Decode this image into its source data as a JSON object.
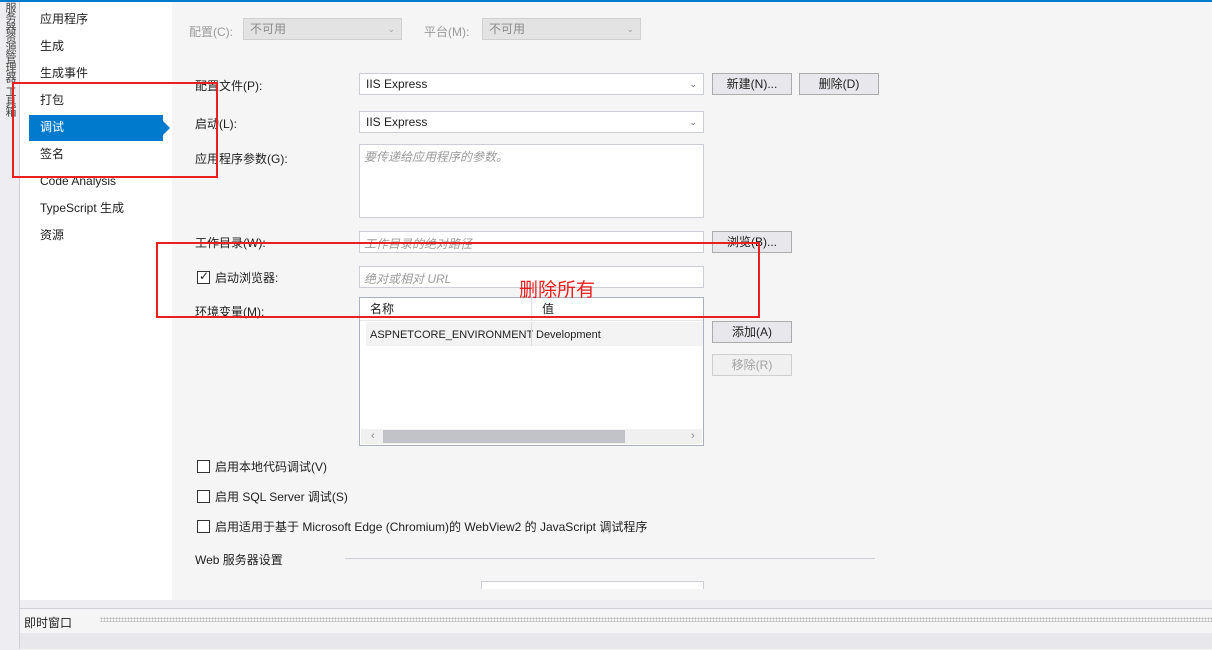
{
  "sidebar_tools": [
    "服务器资源管理器",
    "工具箱"
  ],
  "nav": {
    "items": [
      "应用程序",
      "生成",
      "生成事件",
      "打包",
      "调试",
      "签名",
      "Code Analysis",
      "TypeScript 生成",
      "资源"
    ],
    "selected": "调试"
  },
  "config_bar": {
    "config_label": "配置(C):",
    "config_value": "不可用",
    "platform_label": "平台(M):",
    "platform_value": "不可用"
  },
  "profile": {
    "label": "配置文件(P):",
    "value": "IIS Express",
    "new_button": "新建(N)...",
    "delete_button": "删除(D)"
  },
  "launch": {
    "label": "启动(L):",
    "value": "IIS Express"
  },
  "app_args": {
    "label": "应用程序参数(G):",
    "placeholder": "要传递给应用程序的参数。"
  },
  "working_dir": {
    "label": "工作目录(W):",
    "placeholder": "工作目录的绝对路径",
    "browse_button": "浏览(B)..."
  },
  "launch_browser": {
    "label": "启动浏览器:",
    "checked": true,
    "placeholder": "绝对或相对 URL"
  },
  "env": {
    "label": "环境变量(M):",
    "columns": [
      "名称",
      "值"
    ],
    "rows": [
      {
        "name": "ASPNETCORE_ENVIRONMENT",
        "value": "Development"
      }
    ],
    "add_button": "添加(A)",
    "remove_button": "移除(R)"
  },
  "checkboxes": [
    {
      "label": "启用本地代码调试(V)",
      "checked": false
    },
    {
      "label": "启用 SQL Server 调试(S)",
      "checked": false
    },
    {
      "label": "启用适用于基于 Microsoft Edge (Chromium)的 WebView2 的 JavaScript 调试程序",
      "checked": false
    }
  ],
  "web_server": {
    "section_label": "Web 服务器设置"
  },
  "annotation": {
    "text": "删除所有",
    "color": "#e8201e"
  },
  "bottom_panel": {
    "title": "即时窗口"
  },
  "colors": {
    "accent": "#007acc",
    "annotation_red": "#e8201e"
  }
}
